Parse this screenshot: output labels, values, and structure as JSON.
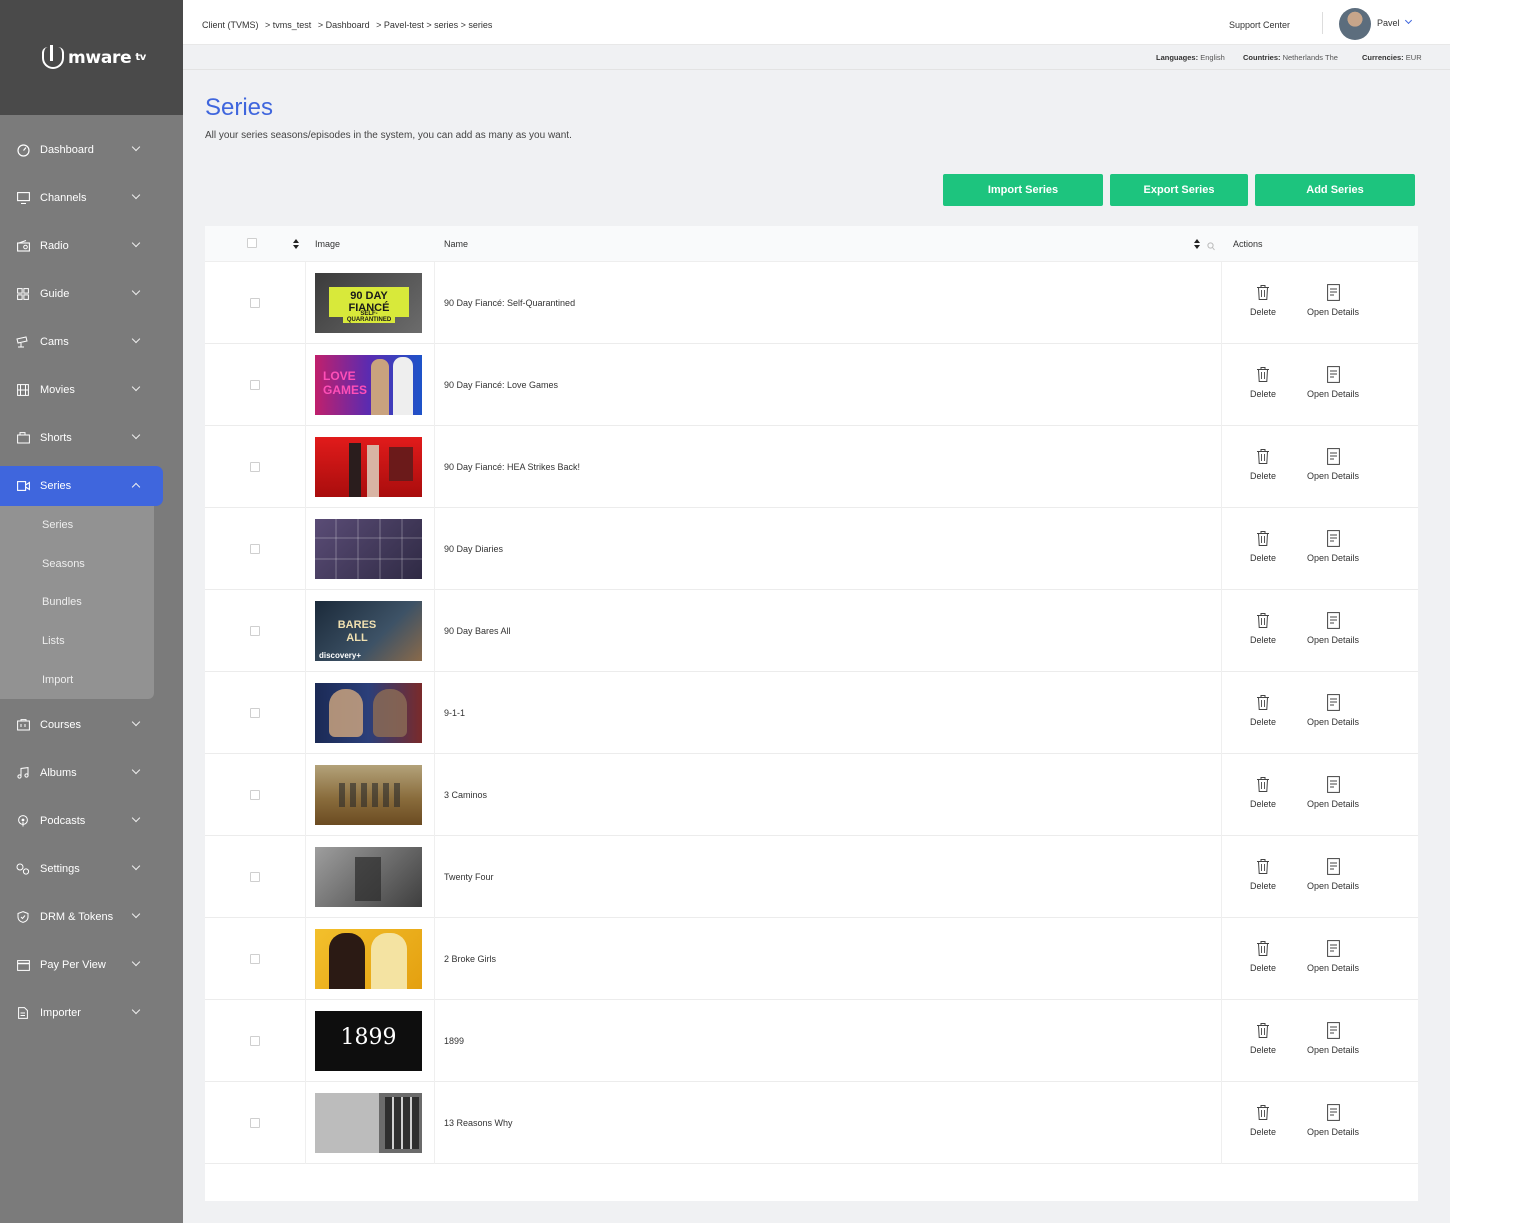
{
  "brand": {
    "logo_text": "mware",
    "logo_sup": "tv"
  },
  "sidebar": {
    "items": [
      {
        "label": "Dashboard",
        "icon": "dashboard-icon"
      },
      {
        "label": "Channels",
        "icon": "monitor-icon"
      },
      {
        "label": "Radio",
        "icon": "radio-icon"
      },
      {
        "label": "Guide",
        "icon": "guide-grid-icon"
      },
      {
        "label": "Cams",
        "icon": "camera-icon"
      },
      {
        "label": "Movies",
        "icon": "film-icon"
      },
      {
        "label": "Shorts",
        "icon": "shorts-icon"
      },
      {
        "label": "Series",
        "icon": "video-icon"
      },
      {
        "label": "Courses",
        "icon": "courses-icon"
      },
      {
        "label": "Albums",
        "icon": "music-icon"
      },
      {
        "label": "Podcasts",
        "icon": "podcast-icon"
      },
      {
        "label": "Settings",
        "icon": "gears-icon"
      },
      {
        "label": "DRM & Tokens",
        "icon": "shield-icon"
      },
      {
        "label": "Pay Per View",
        "icon": "card-icon"
      },
      {
        "label": "Importer",
        "icon": "document-icon"
      }
    ],
    "submenu": [
      "Series",
      "Seasons",
      "Bundles",
      "Lists",
      "Import"
    ]
  },
  "topbar": {
    "breadcrumb": [
      "Client (TVMS)",
      "> tvms_test",
      ">  Dashboard",
      "> Pavel-test > series > series"
    ],
    "support": "Support Center",
    "user": "Pavel"
  },
  "infobar": {
    "languages_label": "Languages:",
    "languages_value": "English",
    "countries_label": "Countries:",
    "countries_value": "Netherlands The",
    "currencies_label": "Currencies:",
    "currencies_value": "EUR"
  },
  "page": {
    "title": "Series",
    "subtitle": "All your series seasons/episodes in the system, you can add as many as you want.",
    "buttons": {
      "import": "Import Series",
      "export": "Export Series",
      "add": "Add Series"
    }
  },
  "table": {
    "headers": {
      "image": "Image",
      "name": "Name",
      "actions": "Actions"
    },
    "delete_label": "Delete",
    "details_label": "Open Details",
    "rows": [
      {
        "name": "90 Day Fiancé: Self-Quarantined",
        "thumb_text": "90 DAY FIANCÉ",
        "thumb_sub": "SELF-QUARANTINED"
      },
      {
        "name": "90 Day Fiancé: Love Games",
        "thumb_text": "LOVE GAMES",
        "thumb_sub": ""
      },
      {
        "name": "90 Day Fiancé: HEA Strikes Back!",
        "thumb_text": "",
        "thumb_sub": ""
      },
      {
        "name": "90 Day Diaries",
        "thumb_text": "",
        "thumb_sub": ""
      },
      {
        "name": "90 Day Bares All",
        "thumb_text": "BARES ALL",
        "thumb_sub": "discovery+"
      },
      {
        "name": "9-1-1",
        "thumb_text": "",
        "thumb_sub": ""
      },
      {
        "name": "3 Caminos",
        "thumb_text": "",
        "thumb_sub": ""
      },
      {
        "name": "Twenty Four",
        "thumb_text": "",
        "thumb_sub": ""
      },
      {
        "name": "2 Broke Girls",
        "thumb_text": "",
        "thumb_sub": ""
      },
      {
        "name": "1899",
        "thumb_text": "1899",
        "thumb_sub": ""
      },
      {
        "name": "13 Reasons Why",
        "thumb_text": "",
        "thumb_sub": ""
      }
    ]
  },
  "colors": {
    "accent": "#3f66dd",
    "button": "#1dc47e",
    "sidebar": "#7b7b7b",
    "logo_bg": "#4a4a4a"
  }
}
